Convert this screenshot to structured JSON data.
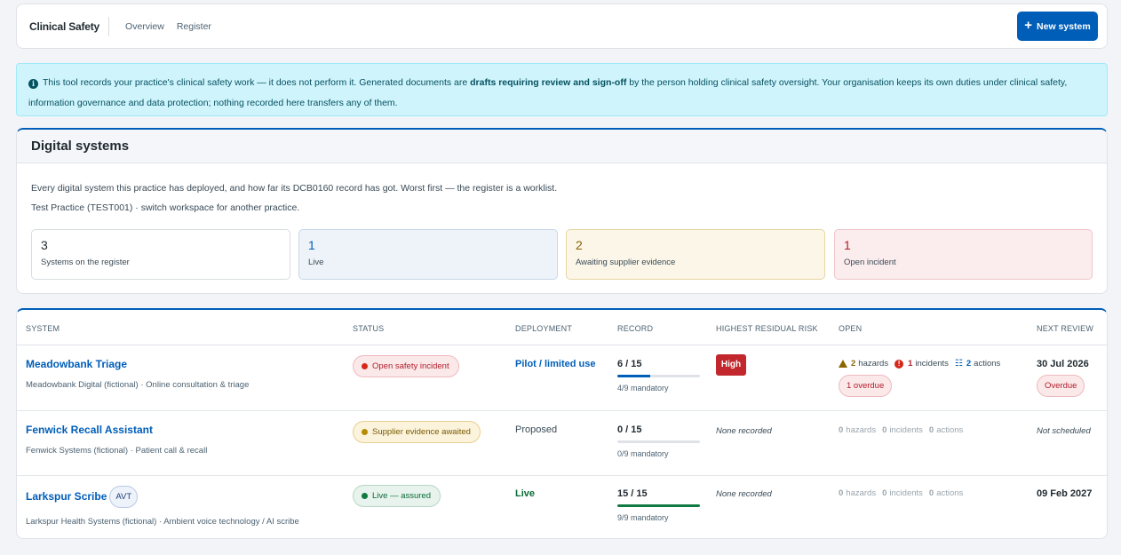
{
  "header": {
    "brand": "Clinical Safety",
    "nav": [
      "Overview",
      "Register"
    ],
    "new_button": "New system"
  },
  "banner": {
    "text_before": "This tool records your practice's clinical safety work — it does not perform it. Generated documents are ",
    "text_bold": "drafts requiring review and sign-off",
    "text_after": " by the person holding clinical safety oversight. Your organisation keeps its own duties under clinical safety, information governance and data protection; nothing recorded here transfers any of them."
  },
  "systems_card": {
    "title": "Digital systems",
    "description": "Every digital system this practice has deployed, and how far its DCB0160 record has got. Worst first — the register is a worklist.",
    "workspace": "Test Practice (TEST001) · switch workspace for another practice.",
    "stats": [
      {
        "value": "3",
        "label": "Systems on the register"
      },
      {
        "value": "1",
        "label": "Live"
      },
      {
        "value": "2",
        "label": "Awaiting supplier evidence"
      },
      {
        "value": "1",
        "label": "Open incident"
      }
    ]
  },
  "table": {
    "columns": [
      "SYSTEM",
      "STATUS",
      "DEPLOYMENT",
      "RECORD",
      "HIGHEST RESIDUAL RISK",
      "OPEN",
      "NEXT REVIEW"
    ],
    "rows": [
      {
        "name": "Meadowbank Triage",
        "badge": "",
        "subtitle": "Meadowbank Digital (fictional) · Online consultation & triage",
        "status": "Open safety incident",
        "deployment": "Pilot / limited use",
        "record": "6 / 15",
        "record_progress": 0.4,
        "mandatory": "4/9 mandatory",
        "risk": "High",
        "hazards": "2",
        "hazards_label": "hazards",
        "incidents": "1",
        "incidents_label": "incidents",
        "actions": "2",
        "actions_label": "actions",
        "overdue": "1 overdue",
        "next_review": "30 Jul 2026",
        "review_flag": "Overdue"
      },
      {
        "name": "Fenwick Recall Assistant",
        "badge": "",
        "subtitle": "Fenwick Systems (fictional) · Patient call & recall",
        "status": "Supplier evidence awaited",
        "deployment": "Proposed",
        "record": "0 / 15",
        "record_progress": 0,
        "mandatory": "0/9 mandatory",
        "risk": "None recorded",
        "hazards": "0",
        "hazards_label": "hazards",
        "incidents": "0",
        "incidents_label": "incidents",
        "actions": "0",
        "actions_label": "actions",
        "next_review": "Not scheduled"
      },
      {
        "name": "Larkspur Scribe",
        "badge": "AVT",
        "subtitle": "Larkspur Health Systems (fictional) · Ambient voice technology / AI scribe",
        "status": "Live — assured",
        "deployment": "Live",
        "record": "15 / 15",
        "record_progress": 1,
        "mandatory": "9/9 mandatory",
        "risk": "None recorded",
        "hazards": "0",
        "hazards_label": "hazards",
        "incidents": "0",
        "incidents_label": "incidents",
        "actions": "0",
        "actions_label": "actions",
        "next_review": "09 Feb 2027"
      }
    ]
  },
  "colors": {
    "primary": "#005eb8",
    "danger": "#d5281b",
    "warning": "#b88a00",
    "success": "#117a43",
    "banner_bg": "#cff4fc"
  }
}
